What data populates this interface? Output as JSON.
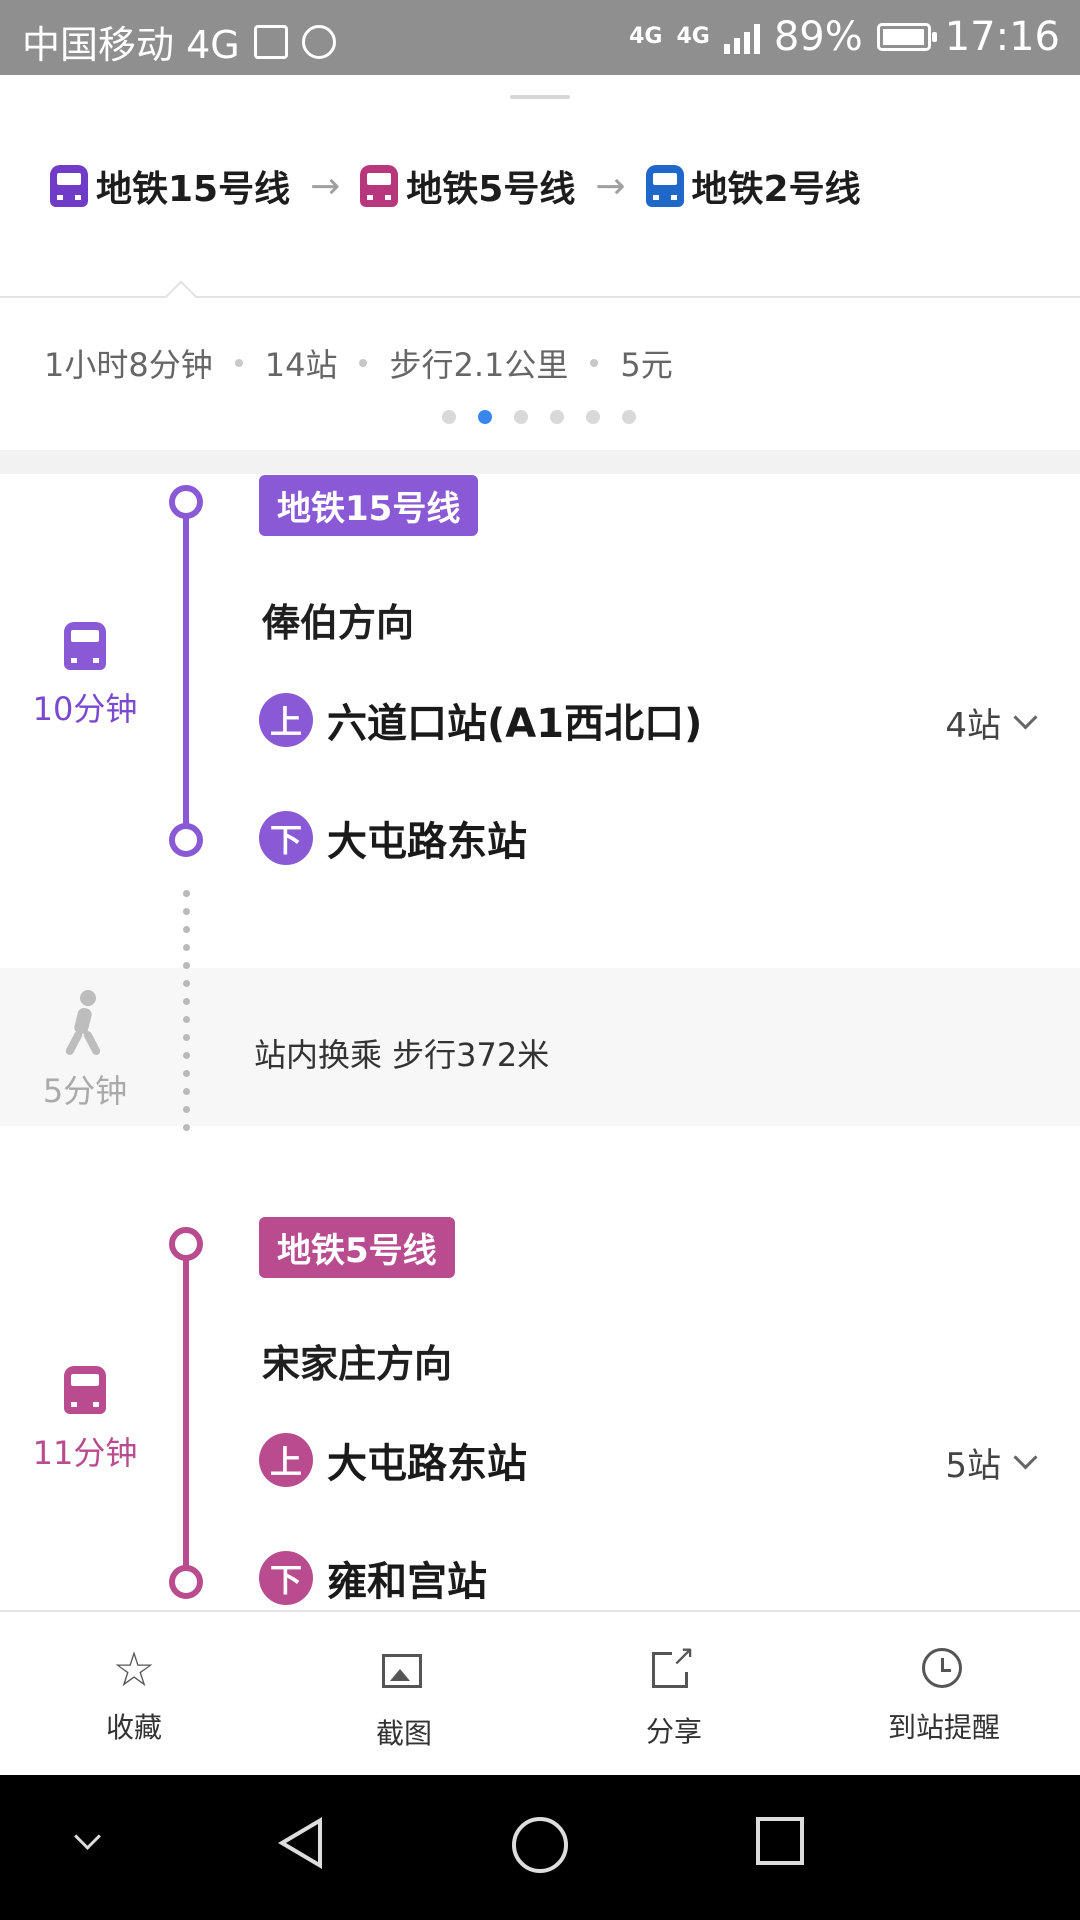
{
  "status_bar": {
    "carrier": "中国移动 4G",
    "net_1": "4G",
    "net_2": "4G",
    "battery_percent": "89%",
    "time": "17:16"
  },
  "route_summary": {
    "lines": [
      {
        "label": "地铁15号线",
        "color": "#6f3bc8"
      },
      {
        "label": "地铁5号线",
        "color": "#b8367c"
      },
      {
        "label": "地铁2号线",
        "color": "#1f67c9"
      }
    ],
    "duration": "1小时8分钟",
    "stops": "14站",
    "walk": "步行2.1公里",
    "fare": "5元",
    "page_count": 6,
    "active_page": 2
  },
  "segments": {
    "seg1": {
      "badge": "地铁15号线",
      "color": "#8a5ad6",
      "direction": "俸伯方向",
      "board_mark": "上",
      "board_station": "六道口站(A1西北口)",
      "stop_count": "4站",
      "alight_mark": "下",
      "alight_station": "大屯路东站",
      "ride_time": "10分钟"
    },
    "transfer": {
      "text": "站内换乘 步行372米",
      "walk_time": "5分钟"
    },
    "seg2": {
      "badge": "地铁5号线",
      "color": "#b94c8f",
      "direction": "宋家庄方向",
      "board_mark": "上",
      "board_station": "大屯路东站",
      "stop_count": "5站",
      "alight_mark": "下",
      "alight_station": "雍和宫站",
      "ride_time": "11分钟"
    }
  },
  "actions": {
    "favorite": "收藏",
    "screenshot": "截图",
    "share": "分享",
    "arrival_alert": "到站提醒"
  }
}
